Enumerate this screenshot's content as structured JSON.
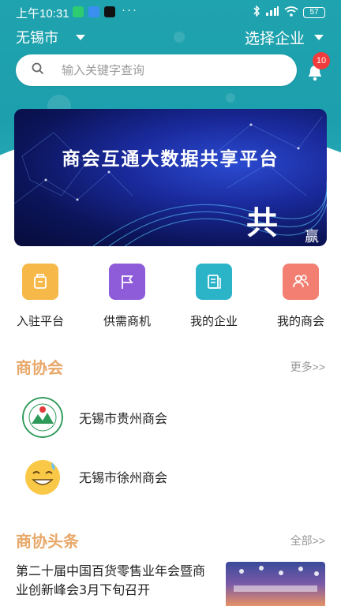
{
  "status_bar": {
    "time": "上午10:31",
    "dots": "···",
    "battery": "57"
  },
  "header": {
    "city": "无锡市",
    "company_select": "选择企业"
  },
  "search": {
    "placeholder": "输入关键字查询"
  },
  "notifications": {
    "count": "10"
  },
  "banner": {
    "title": "商会互通大数据共享平台",
    "deco_char": "共",
    "deco_char2": "赢"
  },
  "quick_entries": [
    {
      "label": "入驻平台",
      "icon": "building-icon",
      "color": "#f7b84a"
    },
    {
      "label": "供需商机",
      "icon": "flag-icon",
      "color": "#8e5bd9"
    },
    {
      "label": "我的企业",
      "icon": "document-icon",
      "color": "#2bb3c8"
    },
    {
      "label": "我的商会",
      "icon": "users-icon",
      "color": "#f27f72"
    }
  ],
  "chamber_section": {
    "title": "商协会",
    "more": "更多>>",
    "items": [
      {
        "name": "无锡市贵州商会",
        "logo": "guizhou-chamber-logo"
      },
      {
        "name": "无锡市徐州商会",
        "logo": "smiling-face-logo"
      }
    ]
  },
  "headlines_section": {
    "title": "商协头条",
    "more": "全部>>",
    "first_news": "第二十届中国百货零售业年会暨商业创新峰会3月下旬召开"
  },
  "colors": {
    "header_teal": "#1fa3ae",
    "accent_orange": "#e8a86a",
    "badge_red": "#f23b3b"
  }
}
